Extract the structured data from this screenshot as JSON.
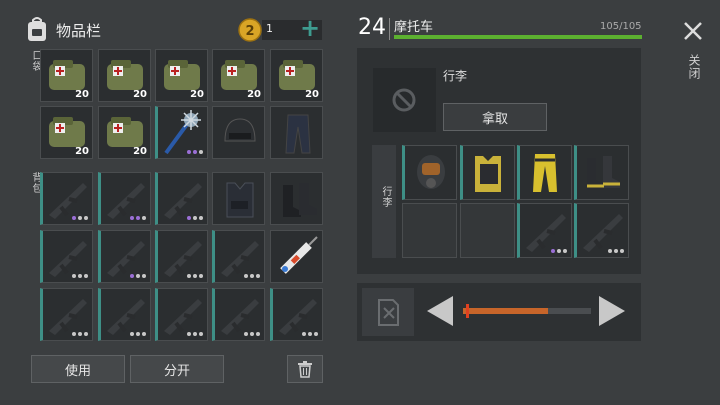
{
  "inventory": {
    "title": "物品栏",
    "coins": "1",
    "plus": "+",
    "pocket_label": "口袋",
    "backpack_label": "背包"
  },
  "vehicle": {
    "level": "24",
    "name": "摩托车",
    "capacity": "105/105",
    "close_label": "关闭"
  },
  "storage": {
    "title": "行李",
    "take_label": "拿取",
    "side_label": "行李"
  },
  "pocket_counts": [
    "20",
    "20",
    "20",
    "20",
    "20",
    "20",
    "20"
  ],
  "actions": {
    "use_label": "使用",
    "split_label": "分开"
  },
  "colors": {
    "accent": "#3e8f86",
    "health": "#5cb030",
    "fuel": "#c7652a",
    "coin": "#d9a526"
  }
}
